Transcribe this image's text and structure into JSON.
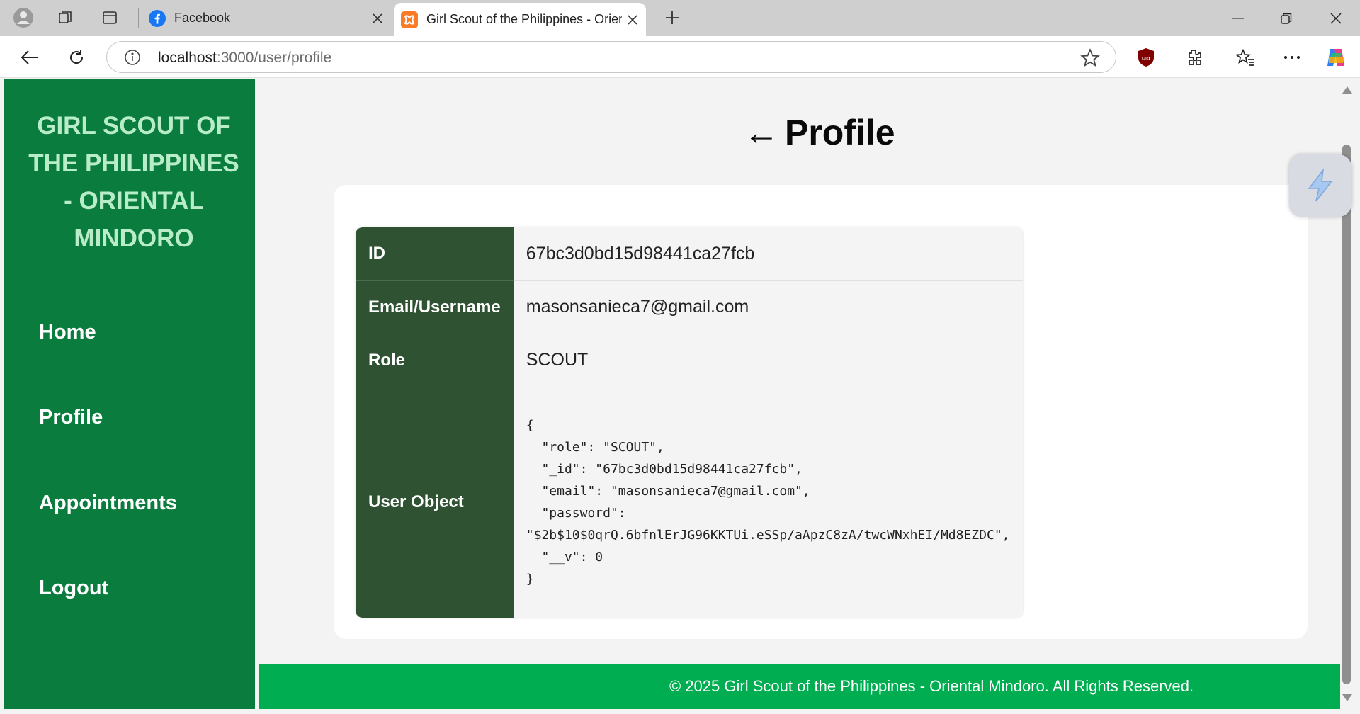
{
  "browser": {
    "tabs": [
      {
        "title": "Facebook",
        "favicon": "facebook-icon"
      },
      {
        "title": "Girl Scout of the Philippines - Oriental Mindoro",
        "favicon": "xampp-icon",
        "active": true
      }
    ],
    "url_host": "localhost",
    "url_rest": ":3000/user/profile"
  },
  "sidebar": {
    "brand": "GIRL SCOUT OF THE PHILIPPINES - ORIENTAL MINDORO",
    "nav": [
      "Home",
      "Profile",
      "Appointments",
      "Logout"
    ]
  },
  "main": {
    "back_arrow": "←",
    "title": "Profile",
    "rows": [
      {
        "label": "ID",
        "value": "67bc3d0bd15d98441ca27fcb"
      },
      {
        "label": "Email/Username",
        "value": "masonsanieca7@gmail.com"
      },
      {
        "label": "Role",
        "value": "SCOUT"
      },
      {
        "label": "User Object",
        "value": "{\n  \"role\": \"SCOUT\",\n  \"_id\": \"67bc3d0bd15d98441ca27fcb\",\n  \"email\": \"masonsanieca7@gmail.com\",\n  \"password\":\n\"$2b$10$0qrQ.6bfnlErJG96KKTUi.eSSp/aApzC8zA/twcWNxhEI/Md8EZDC\",\n  \"__v\": 0\n}"
      }
    ]
  },
  "footer": {
    "text": "© 2025 Girl Scout of the Philippines - Oriental Mindoro. All Rights Reserved."
  },
  "colors": {
    "sidebar": "#0a7d3e",
    "brand_text": "#b9ecc9",
    "table_header": "#2f5233",
    "footer": "#00ad50"
  }
}
